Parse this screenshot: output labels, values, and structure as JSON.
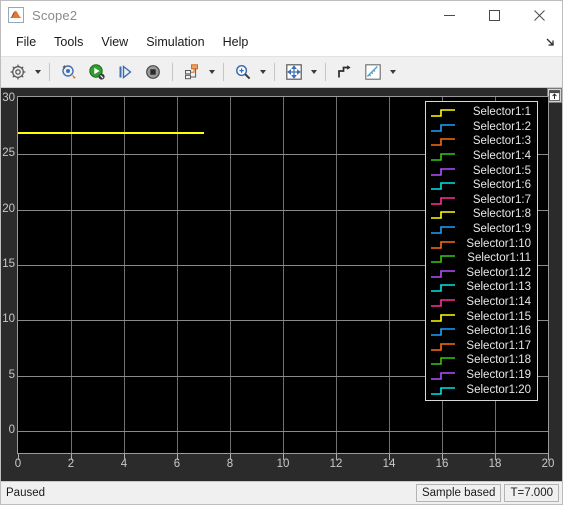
{
  "window": {
    "title": "Scope2",
    "app_icon": "matlab-scope-icon",
    "minimize_label": "Minimize",
    "maximize_label": "Maximize",
    "close_label": "Close"
  },
  "menu": {
    "items": [
      {
        "label": "File",
        "name": "menu-file"
      },
      {
        "label": "Tools",
        "name": "menu-tools"
      },
      {
        "label": "View",
        "name": "menu-view"
      },
      {
        "label": "Simulation",
        "name": "menu-simulation"
      },
      {
        "label": "Help",
        "name": "menu-help"
      }
    ],
    "overflow_icon": "menu-overflow-arrow-icon"
  },
  "toolbar": {
    "buttons": [
      {
        "name": "configuration-properties-button",
        "icon": "gear-icon",
        "has_dropdown": true
      },
      {
        "name": "print-button",
        "icon": "print-scope-icon",
        "has_dropdown": false
      },
      {
        "name": "run-button",
        "icon": "run-green-icon",
        "has_dropdown": false
      },
      {
        "name": "step-forward-button",
        "icon": "step-forward-icon",
        "has_dropdown": false
      },
      {
        "name": "stop-button",
        "icon": "stop-icon",
        "has_dropdown": false
      },
      {
        "name": "signal-selector-button",
        "icon": "signal-selector-icon",
        "has_dropdown": true
      },
      {
        "name": "zoom-in-button",
        "icon": "zoom-in-icon",
        "has_dropdown": true
      },
      {
        "name": "autoscale-button",
        "icon": "autoscale-icon",
        "has_dropdown": true
      },
      {
        "name": "cursor-measurements-button",
        "icon": "cursor-measurements-icon",
        "has_dropdown": false
      },
      {
        "name": "measurements-button",
        "icon": "ruler-icon",
        "has_dropdown": true
      }
    ]
  },
  "statusbar": {
    "state": "Paused",
    "frame_mode": "Sample based",
    "time": "T=7.000"
  },
  "plot": {
    "dock_button_name": "legend-dock-button",
    "dock_icon": "dock-arrow-icon"
  },
  "chart_data": {
    "type": "line",
    "title": "",
    "xlabel": "",
    "ylabel": "",
    "xlim": [
      0,
      20
    ],
    "ylim": [
      0,
      30
    ],
    "xticks": [
      0,
      2,
      4,
      6,
      8,
      10,
      12,
      14,
      16,
      18,
      20
    ],
    "yticks": [
      0,
      5,
      10,
      15,
      20,
      25,
      30
    ],
    "xtick_labels": [
      "0",
      "2",
      "4",
      "6",
      "8",
      "10",
      "12",
      "14",
      "16",
      "18",
      "20"
    ],
    "ytick_labels": [
      "0",
      "5",
      "10",
      "15",
      "20",
      "25",
      "30"
    ],
    "grid": true,
    "background": "#000000",
    "grid_color": "#707070",
    "legend_position": "top-right",
    "colors": [
      "#ffff00",
      "#1f9fff",
      "#ff6a19",
      "#35c715",
      "#b24fff",
      "#00e5e5",
      "#ff2e9a"
    ],
    "series": [
      {
        "name": "Selector1:1",
        "color": "#ffff00",
        "x": [
          0,
          7
        ],
        "values": [
          27,
          27
        ],
        "visible": true
      },
      {
        "name": "Selector1:2",
        "color": "#1f9fff",
        "x": [
          0,
          7
        ],
        "values": [
          0,
          0
        ],
        "visible": false
      },
      {
        "name": "Selector1:3",
        "color": "#ff6a19",
        "x": [
          0,
          7
        ],
        "values": [
          0,
          0
        ],
        "visible": false
      },
      {
        "name": "Selector1:4",
        "color": "#35c715",
        "x": [
          0,
          7
        ],
        "values": [
          0,
          0
        ],
        "visible": false
      },
      {
        "name": "Selector1:5",
        "color": "#b24fff",
        "x": [
          0,
          7
        ],
        "values": [
          0,
          0
        ],
        "visible": false
      },
      {
        "name": "Selector1:6",
        "color": "#00e5e5",
        "x": [
          0,
          7
        ],
        "values": [
          0,
          0
        ],
        "visible": false
      },
      {
        "name": "Selector1:7",
        "color": "#ff2e9a",
        "x": [
          0,
          7
        ],
        "values": [
          0,
          0
        ],
        "visible": false
      },
      {
        "name": "Selector1:8",
        "color": "#ffff00",
        "x": [
          0,
          7
        ],
        "values": [
          0,
          0
        ],
        "visible": false
      },
      {
        "name": "Selector1:9",
        "color": "#1f9fff",
        "x": [
          0,
          7
        ],
        "values": [
          0,
          0
        ],
        "visible": false
      },
      {
        "name": "Selector1:10",
        "color": "#ff6a19",
        "x": [
          0,
          7
        ],
        "values": [
          0,
          0
        ],
        "visible": false
      },
      {
        "name": "Selector1:11",
        "color": "#35c715",
        "x": [
          0,
          7
        ],
        "values": [
          0,
          0
        ],
        "visible": false
      },
      {
        "name": "Selector1:12",
        "color": "#b24fff",
        "x": [
          0,
          7
        ],
        "values": [
          0,
          0
        ],
        "visible": false
      },
      {
        "name": "Selector1:13",
        "color": "#00e5e5",
        "x": [
          0,
          7
        ],
        "values": [
          0,
          0
        ],
        "visible": false
      },
      {
        "name": "Selector1:14",
        "color": "#ff2e9a",
        "x": [
          0,
          7
        ],
        "values": [
          0,
          0
        ],
        "visible": false
      },
      {
        "name": "Selector1:15",
        "color": "#ffff00",
        "x": [
          0,
          7
        ],
        "values": [
          0,
          0
        ],
        "visible": false
      },
      {
        "name": "Selector1:16",
        "color": "#1f9fff",
        "x": [
          0,
          7
        ],
        "values": [
          0,
          0
        ],
        "visible": false
      },
      {
        "name": "Selector1:17",
        "color": "#ff6a19",
        "x": [
          0,
          7
        ],
        "values": [
          0,
          0
        ],
        "visible": false
      },
      {
        "name": "Selector1:18",
        "color": "#35c715",
        "x": [
          0,
          7
        ],
        "values": [
          0,
          0
        ],
        "visible": false
      },
      {
        "name": "Selector1:19",
        "color": "#b24fff",
        "x": [
          0,
          7
        ],
        "values": [
          0,
          0
        ],
        "visible": false
      },
      {
        "name": "Selector1:20",
        "color": "#00e5e5",
        "x": [
          0,
          7
        ],
        "values": [
          0,
          0
        ],
        "visible": false
      }
    ]
  }
}
